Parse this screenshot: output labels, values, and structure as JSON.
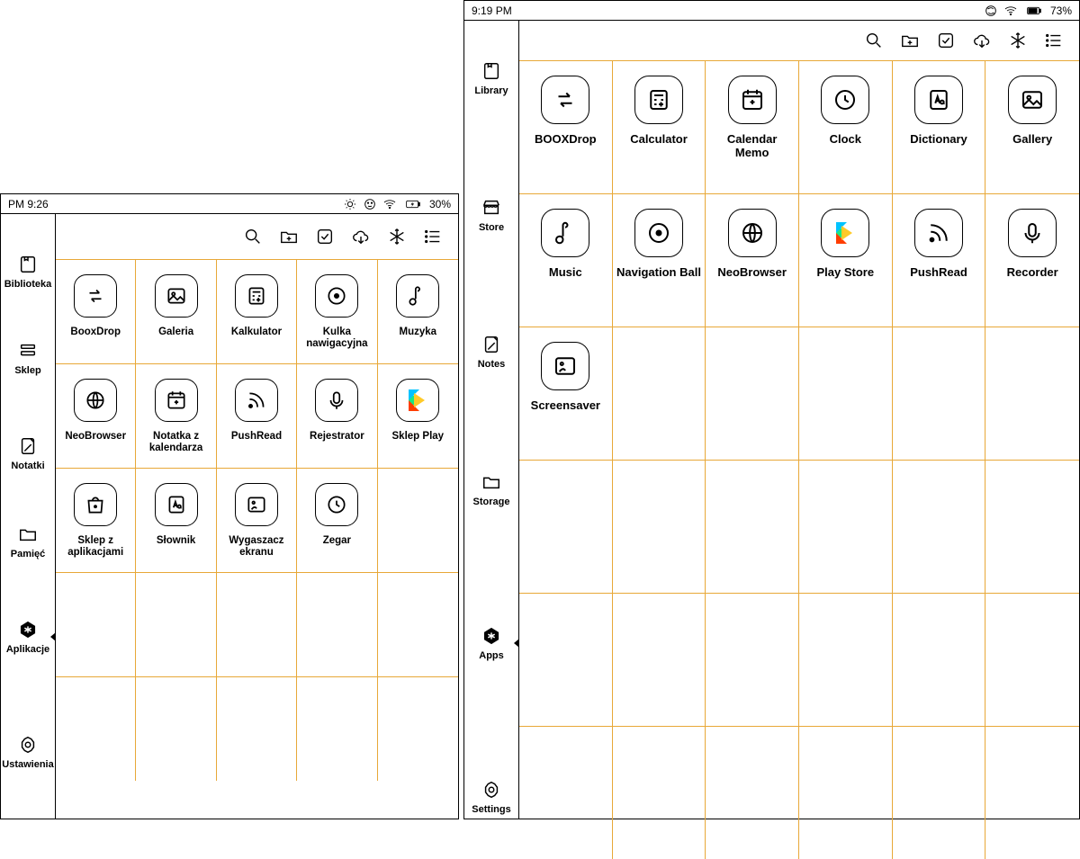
{
  "devices": {
    "left": {
      "status": {
        "time": "PM  9:26",
        "battery": "30%"
      },
      "nav": [
        {
          "key": "library",
          "label": "Biblioteka",
          "icon": "book"
        },
        {
          "key": "store",
          "label": "Sklep",
          "icon": "stack"
        },
        {
          "key": "notes",
          "label": "Notatki",
          "icon": "note"
        },
        {
          "key": "storage",
          "label": "Pamięć",
          "icon": "folder"
        },
        {
          "key": "apps",
          "label": "Aplikacje",
          "icon": "hex",
          "active": true
        },
        {
          "key": "settings",
          "label": "Ustawienia",
          "icon": "gear"
        }
      ],
      "cols": 5,
      "rowHeight": "116px",
      "rows": 5,
      "apps": [
        {
          "label": "BooxDrop",
          "icon": "swap"
        },
        {
          "label": "Galeria",
          "icon": "image"
        },
        {
          "label": "Kalkulator",
          "icon": "calc"
        },
        {
          "label": "Kulka nawigacyjna",
          "icon": "dot"
        },
        {
          "label": "Muzyka",
          "icon": "music"
        },
        {
          "label": "NeoBrowser",
          "icon": "globe"
        },
        {
          "label": "Notatka z kalendarza",
          "icon": "calendar"
        },
        {
          "label": "PushRead",
          "icon": "rss"
        },
        {
          "label": "Rejestrator",
          "icon": "mic"
        },
        {
          "label": "Sklep Play",
          "icon": "play",
          "color": true
        },
        {
          "label": "Sklep z aplikacjami",
          "icon": "bag"
        },
        {
          "label": "Słownik",
          "icon": "dict"
        },
        {
          "label": "Wygaszacz ekranu",
          "icon": "screensaver"
        },
        {
          "label": "Zegar",
          "icon": "clock"
        }
      ]
    },
    "right": {
      "status": {
        "time": "9:19 PM",
        "battery": "73%"
      },
      "nav": [
        {
          "key": "library",
          "label": "Library",
          "icon": "book"
        },
        {
          "key": "store",
          "label": "Store",
          "icon": "storefront"
        },
        {
          "key": "notes",
          "label": "Notes",
          "icon": "note"
        },
        {
          "key": "storage",
          "label": "Storage",
          "icon": "folder"
        },
        {
          "key": "apps",
          "label": "Apps",
          "icon": "hex",
          "active": true
        },
        {
          "key": "settings",
          "label": "Settings",
          "icon": "gear"
        }
      ],
      "cols": 6,
      "rowHeight": "148px",
      "rows": 6,
      "apps": [
        {
          "label": "BOOXDrop",
          "icon": "swap"
        },
        {
          "label": "Calculator",
          "icon": "calc"
        },
        {
          "label": "Calendar Memo",
          "icon": "calendar"
        },
        {
          "label": "Clock",
          "icon": "clock"
        },
        {
          "label": "Dictionary",
          "icon": "dict"
        },
        {
          "label": "Gallery",
          "icon": "image"
        },
        {
          "label": "Music",
          "icon": "music"
        },
        {
          "label": "Navigation Ball",
          "icon": "dot"
        },
        {
          "label": "NeoBrowser",
          "icon": "globe"
        },
        {
          "label": "Play Store",
          "icon": "play",
          "color": true
        },
        {
          "label": "PushRead",
          "icon": "rss"
        },
        {
          "label": "Recorder",
          "icon": "mic"
        },
        {
          "label": "Screensaver",
          "icon": "screensaver"
        }
      ]
    }
  },
  "toolbar": [
    "search",
    "newfolder",
    "select",
    "cloud",
    "freeze",
    "list"
  ]
}
